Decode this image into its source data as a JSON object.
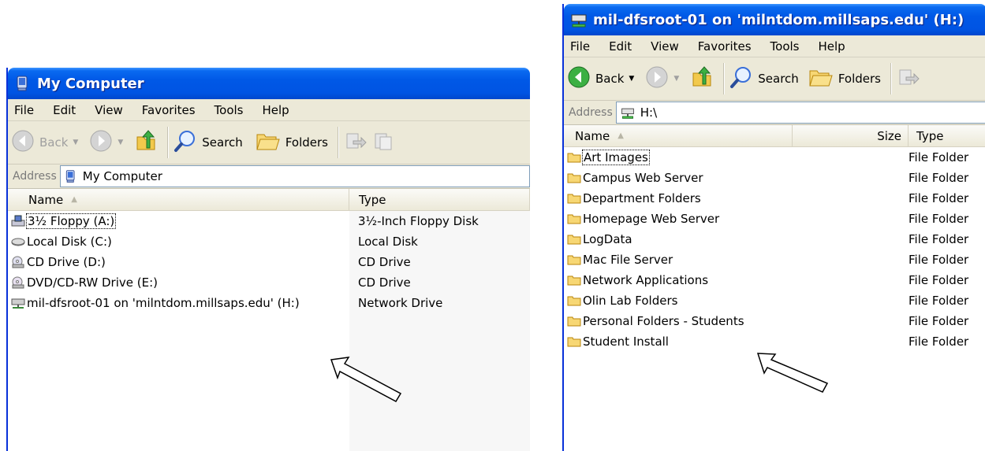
{
  "left_window": {
    "title": "My Computer",
    "menu": [
      "File",
      "Edit",
      "View",
      "Favorites",
      "Tools",
      "Help"
    ],
    "toolbar": {
      "back": "Back",
      "search": "Search",
      "folders": "Folders"
    },
    "address": {
      "label": "Address",
      "value": "My Computer"
    },
    "columns": {
      "name": "Name",
      "type": "Type"
    },
    "rows": [
      {
        "name": "3½ Floppy (A:)",
        "type": "3½-Inch Floppy Disk",
        "icon": "floppy-drive-icon"
      },
      {
        "name": "Local Disk (C:)",
        "type": "Local Disk",
        "icon": "hard-disk-icon"
      },
      {
        "name": "CD Drive (D:)",
        "type": "CD Drive",
        "icon": "cd-drive-icon"
      },
      {
        "name": "DVD/CD-RW Drive (E:)",
        "type": "CD Drive",
        "icon": "dvd-drive-icon"
      },
      {
        "name": "mil-dfsroot-01 on 'milntdom.millsaps.edu' (H:)",
        "type": "Network Drive",
        "icon": "network-drive-icon"
      }
    ]
  },
  "right_window": {
    "title": "mil-dfsroot-01 on 'milntdom.millsaps.edu' (H:)",
    "menu": [
      "File",
      "Edit",
      "View",
      "Favorites",
      "Tools",
      "Help"
    ],
    "toolbar": {
      "back": "Back",
      "search": "Search",
      "folders": "Folders"
    },
    "address": {
      "label": "Address",
      "value": "H:\\"
    },
    "columns": {
      "name": "Name",
      "size": "Size",
      "type": "Type"
    },
    "rows": [
      {
        "name": "Art Images",
        "type": "File Folder"
      },
      {
        "name": "Campus Web Server",
        "type": "File Folder"
      },
      {
        "name": "Department Folders",
        "type": "File Folder"
      },
      {
        "name": "Homepage Web Server",
        "type": "File Folder"
      },
      {
        "name": "LogData",
        "type": "File Folder"
      },
      {
        "name": "Mac File Server",
        "type": "File Folder"
      },
      {
        "name": "Network Applications",
        "type": "File Folder"
      },
      {
        "name": "Olin Lab Folders",
        "type": "File Folder"
      },
      {
        "name": "Personal Folders - Students",
        "type": "File Folder"
      },
      {
        "name": "Student Install",
        "type": "File Folder"
      }
    ]
  }
}
